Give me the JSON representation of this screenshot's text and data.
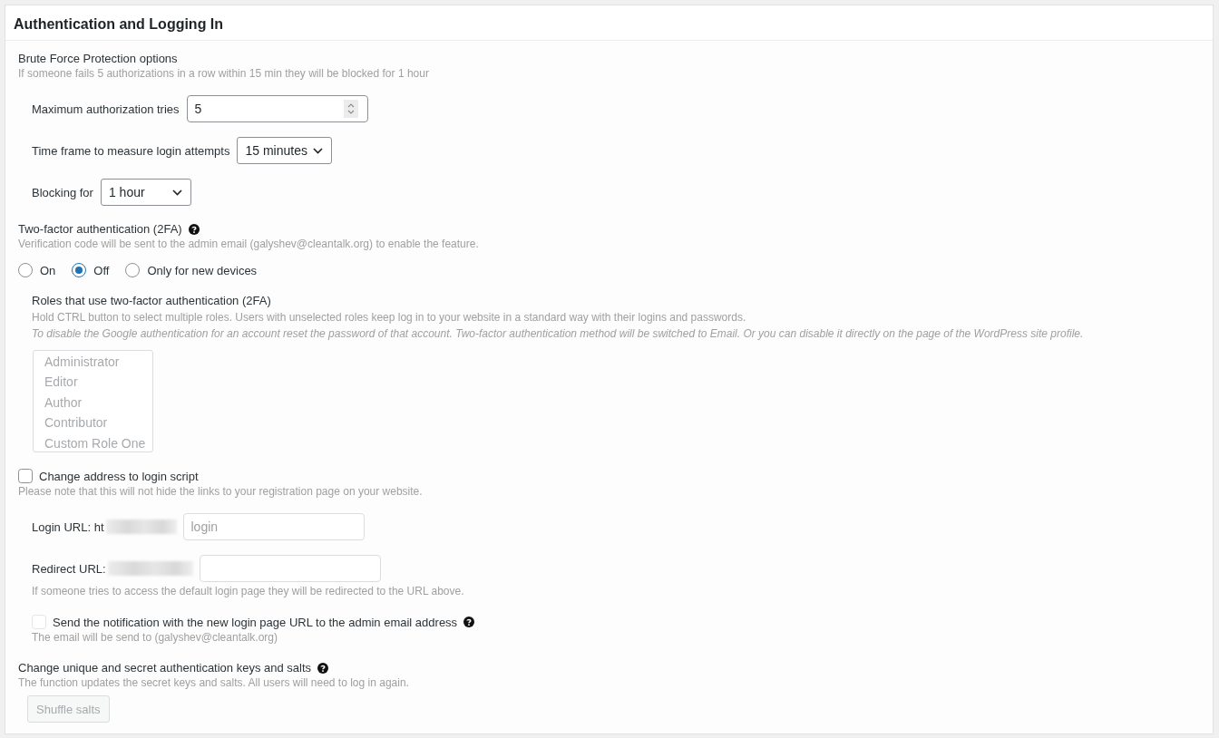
{
  "section": {
    "title": "Authentication and Logging In"
  },
  "brute_force": {
    "title": "Brute Force Protection options",
    "description": "If someone fails 5 authorizations in a row within 15 min they will be blocked for 1 hour",
    "fields": [
      {
        "kind": "number",
        "label": "Maximum authorization tries",
        "value": "5"
      },
      {
        "kind": "select",
        "label": "Time frame to measure login attempts",
        "value": "15 minutes"
      },
      {
        "kind": "select",
        "label": "Blocking for",
        "value": "1 hour"
      }
    ]
  },
  "two_factor": {
    "title": "Two-factor authentication (2FA)",
    "description": "Verification code will be sent to the admin email (galyshev@cleantalk.org) to enable the feature.",
    "options": [
      {
        "label": "On",
        "selected": false
      },
      {
        "label": "Off",
        "selected": true
      },
      {
        "label": "Only for new devices",
        "selected": false
      }
    ],
    "roles": {
      "title": "Roles that use two-factor authentication (2FA)",
      "description": "Hold CTRL button to select multiple roles. Users with unselected roles keep log in to your website in a standard way with their logins and passwords.",
      "note": "To disable the Google authentication for an account reset the password of that account. Two-factor authentication method will be switched to Email. Or you can disable it directly on the page of the WordPress site profile.",
      "disabled": true,
      "items": [
        {
          "label": "Administrator",
          "selected": false
        },
        {
          "label": "Editor",
          "selected": false
        },
        {
          "label": "Author",
          "selected": false
        },
        {
          "label": "Contributor",
          "selected": false
        },
        {
          "label": "Custom Role One",
          "selected": false
        }
      ]
    }
  },
  "login_address": {
    "label": "Change address to login script",
    "checked": false,
    "description": "Please note that this will not hide the links to your registration page on your website.",
    "url_fields": [
      {
        "label": "Login URL: ht",
        "placeholder": "login"
      },
      {
        "label": "Redirect URL:"
      }
    ],
    "redirect_note": "If someone tries to access the default login page they will be redirected to the URL above.",
    "notification": {
      "label": "Send the notification with the new login page URL to the admin email address",
      "checked": false,
      "disabled": true,
      "description": "The email will be send to (galyshev@cleantalk.org)"
    }
  },
  "salts": {
    "title": "Change unique and secret authentication keys and salts",
    "description": "The function updates the secret keys and salts. All users will need to log in again.",
    "button": {
      "label": "Shuffle salts",
      "disabled": true
    }
  }
}
